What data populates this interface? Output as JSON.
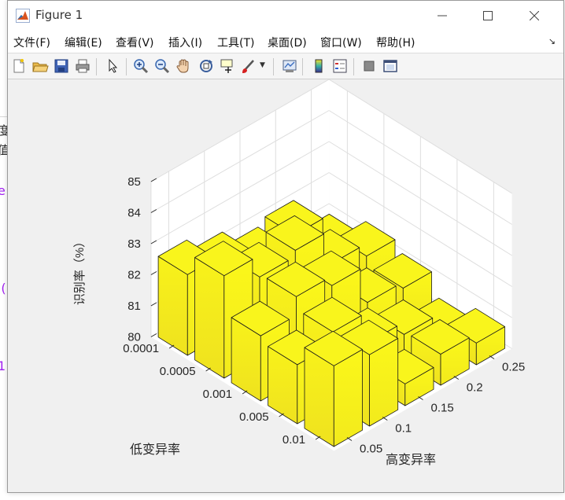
{
  "window": {
    "title": "Figure 1",
    "controls": [
      "minimize",
      "maximize",
      "close"
    ]
  },
  "menu": [
    "文件(F)",
    "编辑(E)",
    "查看(V)",
    "插入(I)",
    "工具(T)",
    "桌面(D)",
    "窗口(W)",
    "帮助(H)"
  ],
  "toolbar_icons": [
    "new-figure-icon",
    "open-file-icon",
    "save-icon",
    "print-icon",
    "pointer-icon",
    "zoom-in-icon",
    "zoom-out-icon",
    "pan-icon",
    "rotate-3d-icon",
    "data-cursor-icon",
    "brush-icon",
    "link-plot-icon",
    "colorbar-icon",
    "legend-icon",
    "hide-plot-tools-icon",
    "show-plot-tools-icon"
  ],
  "background_fragments": [
    "度",
    "值",
    "e",
    "'(",
    "1"
  ],
  "chart_data": {
    "type": "bar3",
    "title": "",
    "xlabel": "高变异率",
    "ylabel": "低变异率",
    "zlabel": "识别率（%）",
    "x_ticks": [
      "0.05",
      "0.1",
      "0.15",
      "0.2",
      "0.25"
    ],
    "y_ticks": [
      "0.0001",
      "0.0005",
      "0.001",
      "0.005",
      "0.01"
    ],
    "z_ticks": [
      "80",
      "81",
      "82",
      "83",
      "84",
      "85"
    ],
    "zlim": [
      80,
      85
    ],
    "grid": true,
    "bar_color": "#f8f21a",
    "values": [
      [
        82.6,
        82.2,
        81.7,
        81.9,
        80.8
      ],
      [
        83.3,
        82.6,
        82.8,
        81.7,
        81.3
      ],
      [
        82.1,
        82.7,
        82.4,
        81.2,
        81.0
      ],
      [
        81.9,
        82.3,
        81.3,
        80.9,
        80.3
      ],
      [
        82.6,
        82.3,
        80.7,
        81.0,
        80.7
      ]
    ]
  }
}
